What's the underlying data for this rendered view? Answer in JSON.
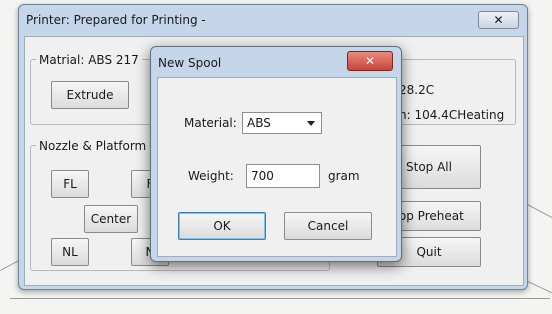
{
  "main_window": {
    "title": "Printer: Prepared for Printing -",
    "close_glyph": "✕",
    "material_group_title": "Matrial: ABS 217",
    "extrude_label": "Extrude",
    "temp_1": "28.2C",
    "temp_2": "n: 104.4CHeating",
    "nozzle_group_title": "Nozzle & Platform",
    "fl_label": "FL",
    "fr_partial_label": "F",
    "center_label": "Center",
    "nl_label": "NL",
    "nr_partial_label": "N",
    "stop_all_label": "Stop All",
    "stop_preheat_label": "top Preheat",
    "quit_label": "Quit"
  },
  "dialog": {
    "title": "New Spool",
    "close_glyph": "✕",
    "material_label": "Material:",
    "material_value": "ABS",
    "weight_label": "Weight:",
    "weight_value": "700",
    "weight_unit": "gram",
    "ok_label": "OK",
    "cancel_label": "Cancel"
  },
  "colors": {
    "window_frame": "#c6d6ea",
    "dialog_close": "#c8453a",
    "client_bg": "#f0f0f0"
  },
  "icons": {
    "close": "close-icon",
    "dropdown": "chevron-down-icon"
  }
}
